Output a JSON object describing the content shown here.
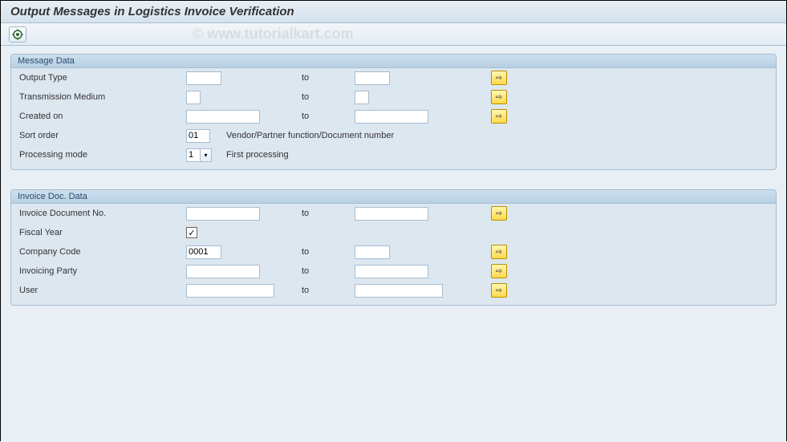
{
  "header": {
    "title": "Output Messages in Logistics Invoice Verification"
  },
  "watermark": "© www.tutorialkart.com",
  "groups": {
    "message_data": {
      "title": "Message Data",
      "output_type_label": "Output Type",
      "output_type_from": "",
      "output_type_to": "",
      "trans_medium_label": "Transmission Medium",
      "trans_medium_from": "",
      "trans_medium_to": "",
      "created_on_label": "Created on",
      "created_on_from": "",
      "created_on_to": "",
      "sort_order_label": "Sort order",
      "sort_order_value": "01",
      "sort_order_desc": "Vendor/Partner function/Document number",
      "proc_mode_label": "Processing mode",
      "proc_mode_value": "1",
      "proc_mode_desc": "First processing",
      "to_text": "to"
    },
    "invoice_data": {
      "title": "Invoice Doc. Data",
      "doc_no_label": "Invoice Document No.",
      "doc_no_from": "",
      "doc_no_to": "",
      "fiscal_year_label": "Fiscal Year",
      "fiscal_year_checked": "✓",
      "company_code_label": "Company Code",
      "company_code_from": "0001",
      "company_code_to": "",
      "inv_party_label": "Invoicing Party",
      "inv_party_from": "",
      "inv_party_to": "",
      "user_label": "User",
      "user_from": "",
      "user_to": "",
      "to_text": "to"
    }
  },
  "icons": {
    "execute": "⊕",
    "multi_select": "⇨"
  }
}
